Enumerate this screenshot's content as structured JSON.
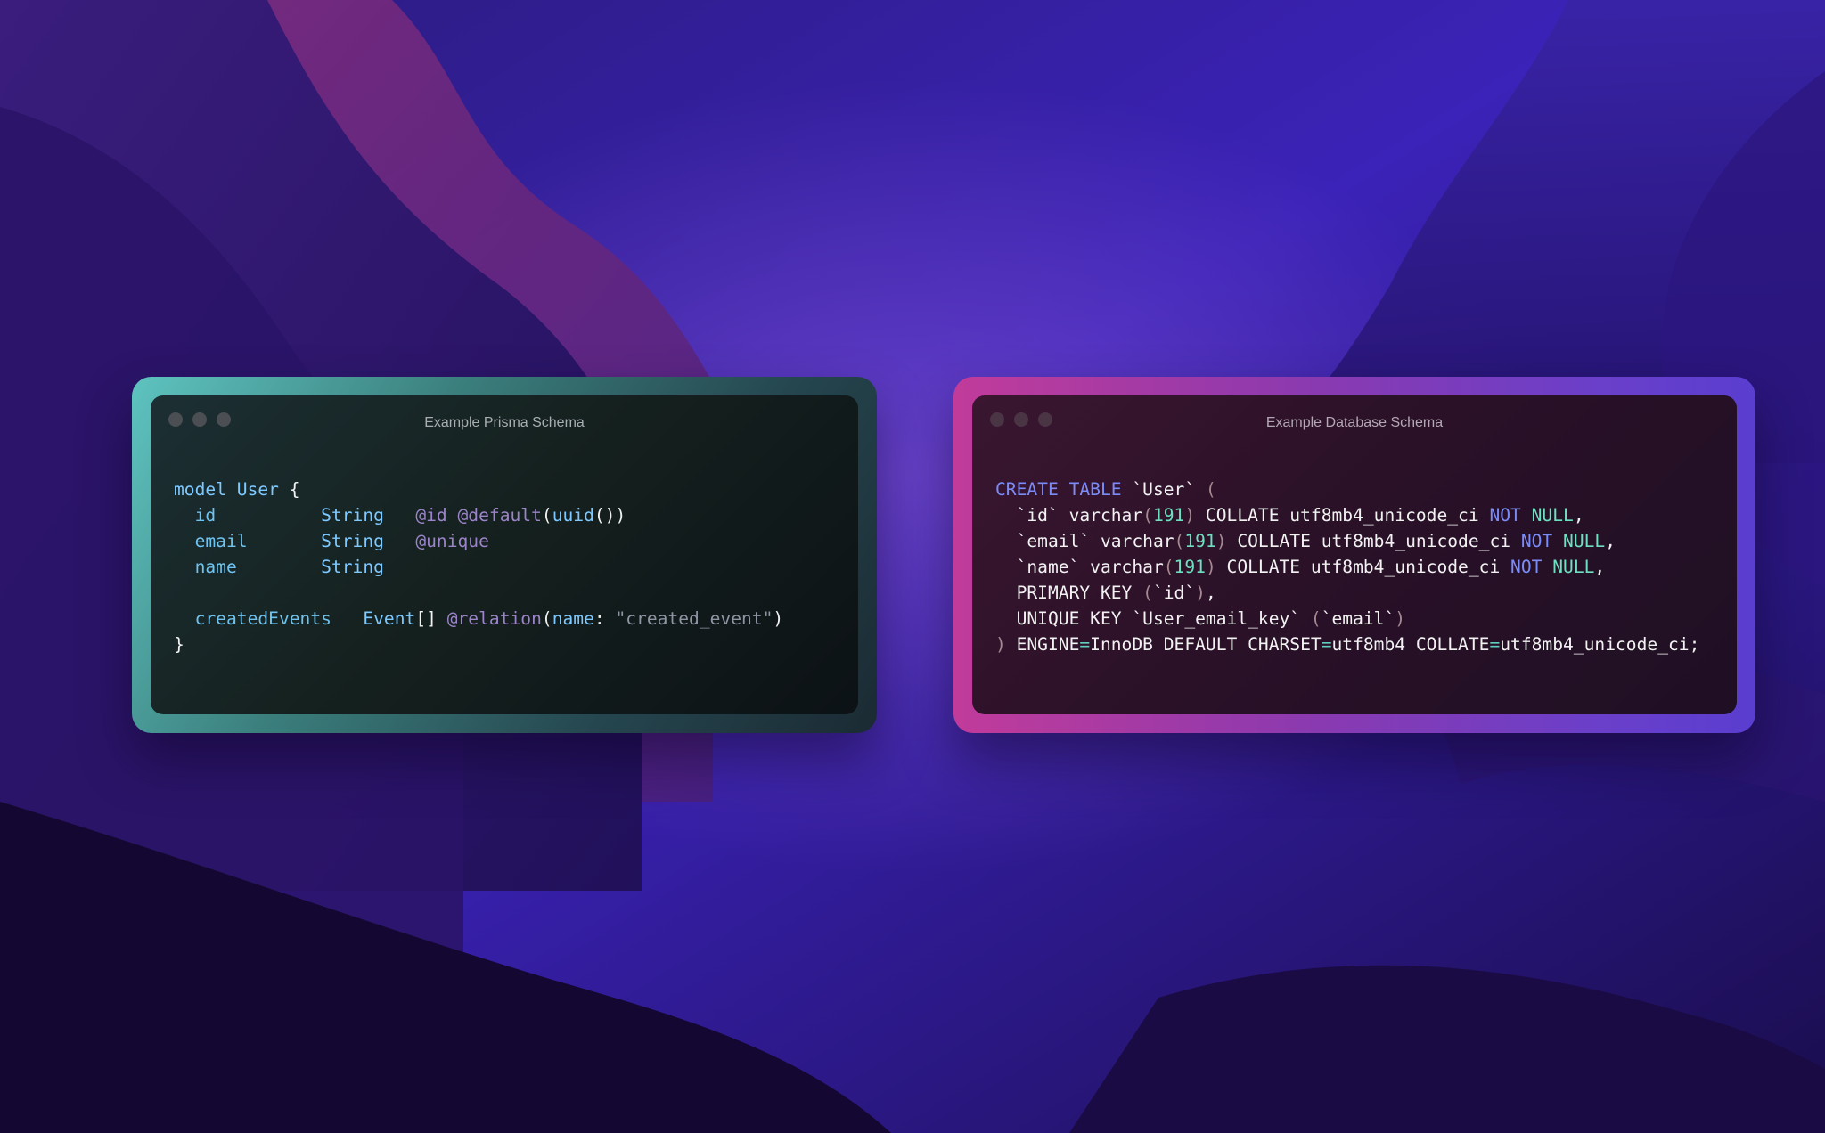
{
  "colors": {
    "left_frame_accent": "#5ec3bf",
    "right_frame_accent": "#c13b9a",
    "keyword": "#7ec9ff",
    "attribute": "#9b84c9",
    "string": "#8f95a3",
    "sql_keyword": "#7b8cf7",
    "number": "#6ee0c0"
  },
  "left_window": {
    "title": "Example Prisma Schema",
    "lines": [
      {
        "tokens": [
          {
            "t": "model ",
            "c": "kw"
          },
          {
            "t": "User",
            "c": "type"
          },
          {
            "t": " {",
            "c": "plain"
          }
        ]
      },
      {
        "tokens": [
          {
            "t": "  id          ",
            "c": "field"
          },
          {
            "t": "String",
            "c": "type"
          },
          {
            "t": "   ",
            "c": "plain"
          },
          {
            "t": "@id @default",
            "c": "attr"
          },
          {
            "t": "(",
            "c": "plain"
          },
          {
            "t": "uuid",
            "c": "fn"
          },
          {
            "t": "())",
            "c": "plain"
          }
        ]
      },
      {
        "tokens": [
          {
            "t": "  email       ",
            "c": "field"
          },
          {
            "t": "String",
            "c": "type"
          },
          {
            "t": "   ",
            "c": "plain"
          },
          {
            "t": "@unique",
            "c": "attr"
          }
        ]
      },
      {
        "tokens": [
          {
            "t": "  name        ",
            "c": "field"
          },
          {
            "t": "String",
            "c": "type"
          }
        ]
      },
      {
        "tokens": []
      },
      {
        "tokens": [
          {
            "t": "  createdEvents   ",
            "c": "field"
          },
          {
            "t": "Event",
            "c": "type"
          },
          {
            "t": "[] ",
            "c": "plain"
          },
          {
            "t": "@relation",
            "c": "attr"
          },
          {
            "t": "(",
            "c": "plain"
          },
          {
            "t": "name",
            "c": "fn"
          },
          {
            "t": ": ",
            "c": "plain"
          },
          {
            "t": "\"created_event\"",
            "c": "str"
          },
          {
            "t": ")",
            "c": "plain"
          }
        ]
      },
      {
        "tokens": [
          {
            "t": "}",
            "c": "plain"
          }
        ]
      }
    ]
  },
  "right_window": {
    "title": "Example Database Schema",
    "lines": [
      {
        "tokens": [
          {
            "t": "CREATE TABLE ",
            "c": "sqlkw"
          },
          {
            "t": "`User` ",
            "c": "plain"
          },
          {
            "t": "(",
            "c": "punct"
          }
        ]
      },
      {
        "tokens": [
          {
            "t": "  `id` varchar",
            "c": "plain"
          },
          {
            "t": "(",
            "c": "punct"
          },
          {
            "t": "191",
            "c": "num"
          },
          {
            "t": ")",
            "c": "punct"
          },
          {
            "t": " COLLATE utf8mb4_unicode_ci ",
            "c": "plain"
          },
          {
            "t": "NOT",
            "c": "sqlkw"
          },
          {
            "t": " ",
            "c": "plain"
          },
          {
            "t": "NULL",
            "c": "null"
          },
          {
            "t": ",",
            "c": "plain"
          }
        ]
      },
      {
        "tokens": [
          {
            "t": "  `email` varchar",
            "c": "plain"
          },
          {
            "t": "(",
            "c": "punct"
          },
          {
            "t": "191",
            "c": "num"
          },
          {
            "t": ")",
            "c": "punct"
          },
          {
            "t": " COLLATE utf8mb4_unicode_ci ",
            "c": "plain"
          },
          {
            "t": "NOT",
            "c": "sqlkw"
          },
          {
            "t": " ",
            "c": "plain"
          },
          {
            "t": "NULL",
            "c": "null"
          },
          {
            "t": ",",
            "c": "plain"
          }
        ]
      },
      {
        "tokens": [
          {
            "t": "  `name` varchar",
            "c": "plain"
          },
          {
            "t": "(",
            "c": "punct"
          },
          {
            "t": "191",
            "c": "num"
          },
          {
            "t": ")",
            "c": "punct"
          },
          {
            "t": " COLLATE utf8mb4_unicode_ci ",
            "c": "plain"
          },
          {
            "t": "NOT",
            "c": "sqlkw"
          },
          {
            "t": " ",
            "c": "plain"
          },
          {
            "t": "NULL",
            "c": "null"
          },
          {
            "t": ",",
            "c": "plain"
          }
        ]
      },
      {
        "tokens": [
          {
            "t": "  PRIMARY KEY ",
            "c": "plain"
          },
          {
            "t": "(",
            "c": "punct"
          },
          {
            "t": "`id`",
            "c": "plain"
          },
          {
            "t": ")",
            "c": "punct"
          },
          {
            "t": ",",
            "c": "plain"
          }
        ]
      },
      {
        "tokens": [
          {
            "t": "  UNIQUE KEY `User_email_key` ",
            "c": "plain"
          },
          {
            "t": "(",
            "c": "punct"
          },
          {
            "t": "`email`",
            "c": "plain"
          },
          {
            "t": ")",
            "c": "punct"
          }
        ]
      },
      {
        "tokens": [
          {
            "t": ")",
            "c": "punct"
          },
          {
            "t": " ENGINE",
            "c": "plain"
          },
          {
            "t": "=",
            "c": "op"
          },
          {
            "t": "InnoDB DEFAULT CHARSET",
            "c": "plain"
          },
          {
            "t": "=",
            "c": "op"
          },
          {
            "t": "utf8mb4 COLLATE",
            "c": "plain"
          },
          {
            "t": "=",
            "c": "op"
          },
          {
            "t": "utf8mb4_unicode_ci;",
            "c": "plain"
          }
        ]
      }
    ]
  }
}
